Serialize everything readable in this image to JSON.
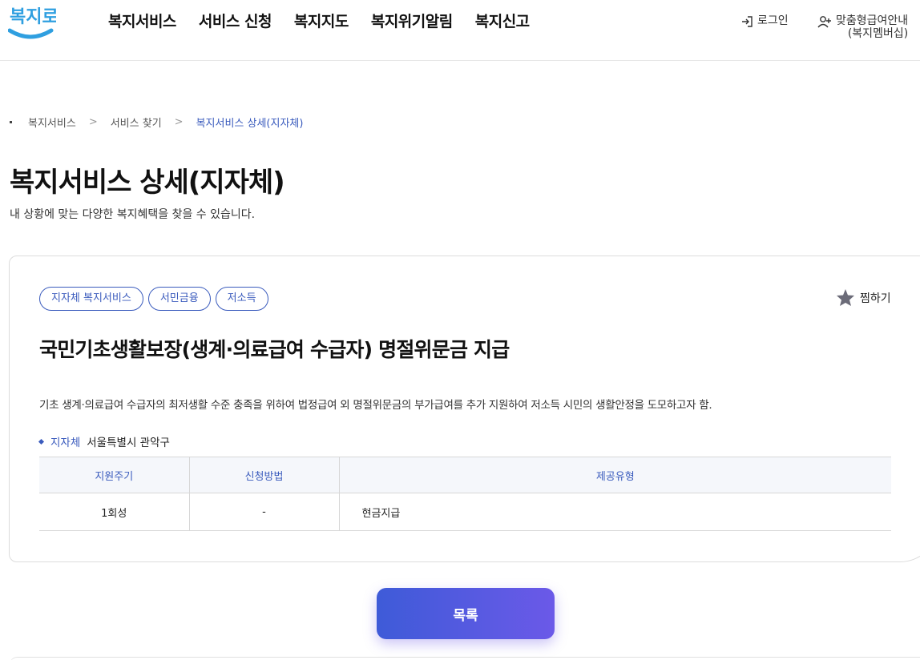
{
  "brand": {
    "logo_text": "복지로",
    "logo_color": "#2f9fe0",
    "accent": "#3a5bbd"
  },
  "gnb": [
    "복지서비스",
    "서비스 신청",
    "복지지도",
    "복지위기알림",
    "복지신고"
  ],
  "util": {
    "login": "로그인",
    "member_line1": "맞춤형급여안내",
    "member_line2": "(복지멤버십)"
  },
  "breadcrumb": {
    "home": "복지서비스",
    "step2": "서비스 찾기",
    "current": "복지서비스 상세(지자체)",
    "separator": ">"
  },
  "page": {
    "title": "복지서비스 상세(지자체)",
    "desc": "내 상황에 맞는 다양한 복지혜택을 찾을 수 있습니다."
  },
  "service": {
    "tags": [
      "지자체 복지서비스",
      "서민금융",
      "저소득"
    ],
    "favorite_label": "찜하기",
    "title": "국민기초생활보장(생계·의료급여 수급자)  명절위문금 지급",
    "desc": "기초 생계·의료급여 수급자의 최저생활 수준 충족을 위하여 법정급여 외 명절위문금의 부가급여를 추가 지원하여 저소득 시민의 생활안정을 도모하고자 함.",
    "agency_label": "지자체",
    "agency_value": "서울특별시 관악구",
    "table": {
      "headers": [
        "지원주기",
        "신청방법",
        "제공유형"
      ],
      "row": [
        "1회성",
        "-",
        "현금지급"
      ]
    }
  },
  "list_button": "목록"
}
